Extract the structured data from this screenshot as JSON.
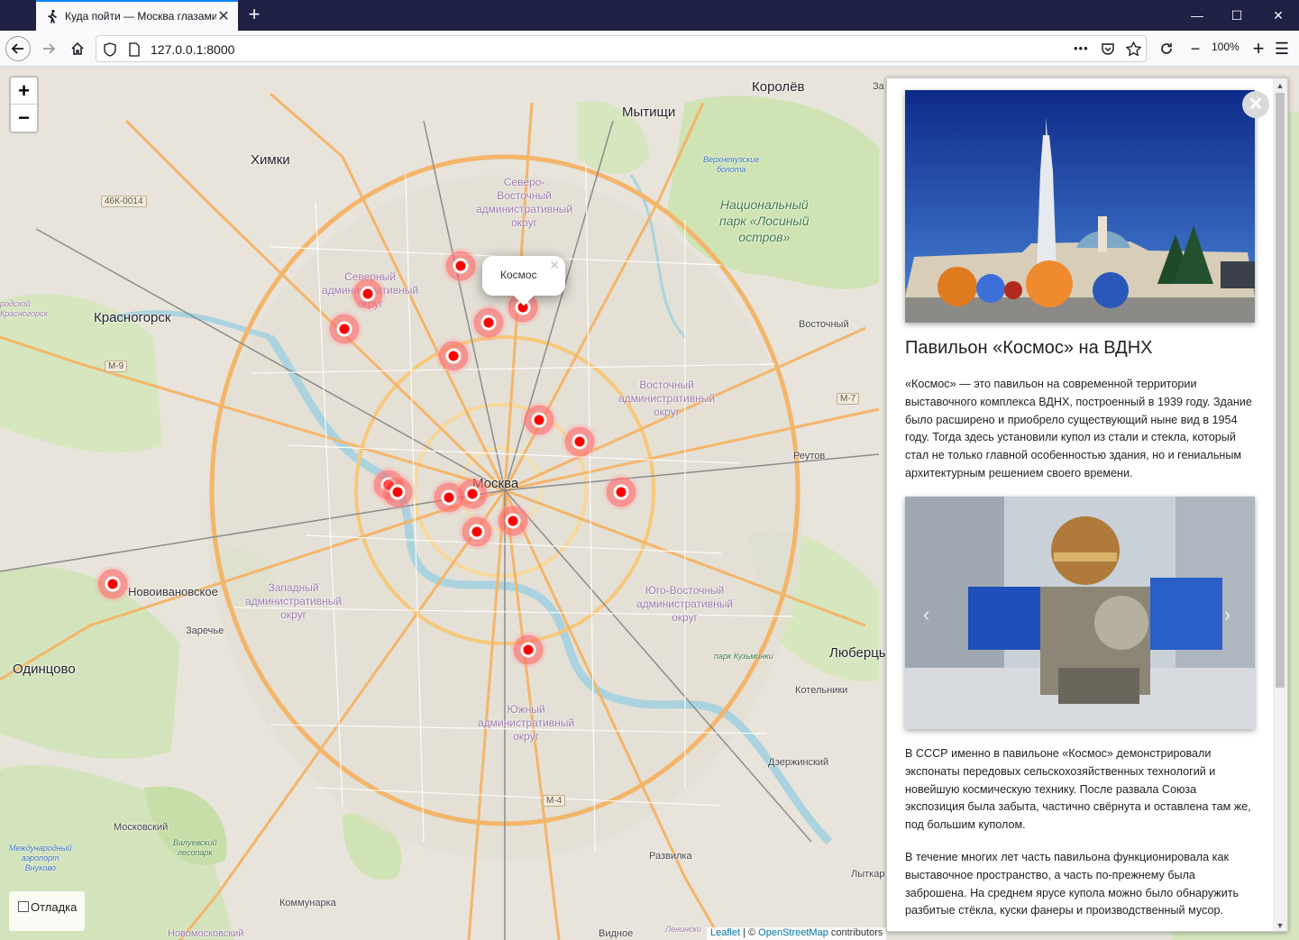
{
  "browser": {
    "tab_title": "Куда пойти — Москва глазами",
    "tab_close": "✕",
    "new_tab": "+",
    "url": "127.0.0.1:8000",
    "more": "•••",
    "zoom": "100%",
    "zoom_out": "−",
    "zoom_in": "+",
    "menu": "☰",
    "minimize": "—",
    "maximize": "☐",
    "close": "✕"
  },
  "map": {
    "zoom_in": "+",
    "zoom_out": "−",
    "labels": {
      "korolev": "Королёв",
      "mytishchi": "Мытищи",
      "khimki": "Химки",
      "krasnogorsk": "Красногорск",
      "moskva": "Москва",
      "odintsovo": "Одинцово",
      "novoivanovskoe": "Новоивановское",
      "zarechye": "Заречье",
      "lyubertsy": "Люберцы",
      "kotelniki": "Котельники",
      "dzerzhinsky": "Дзержинский",
      "reutov": "Реутов",
      "vostochny": "Восточный",
      "moskovsky": "Московский",
      "kommunarka": "Коммунарка",
      "razvilka": "Развилка",
      "vidnoe": "Видное",
      "lytkar": "Лыткар",
      "krasnogorsk_small": "родской\nКрасногорск",
      "za": "За",
      "district_sv": "Северо-\nВосточный\nадминистративный\nокруг",
      "district_s": "Северный\nадминистративный\nокруг",
      "district_v": "Восточный\nадминистративный\nокруг",
      "district_z": "Западный\nадминистративный\nокруг",
      "district_yv": "Юго-Восточный\nадминистративный\nокруг",
      "district_yu": "Южный\nадминистративный\nокруг",
      "park_losiny": "Национальный\nпарк «Лосиный\nостров»",
      "verkhneyauzskie": "Верхнеяузские\nболота",
      "park_kuzminki": "парк Кузьминки",
      "valuevsky": "Валуевский\nлесопарк",
      "vnukovo": "Международный\nаэропорт\nВнуково",
      "novomoskovsky": "Новомосковский",
      "leninsky": "Ленински",
      "road_46k": "46К-0014",
      "road_m9": "М-9",
      "road_m7": "М-7",
      "road_m4": "М-4"
    },
    "popup_title": "Космос",
    "popup_close": "✕",
    "debug_label": "Отладка",
    "attribution_leaflet": "Leaflet",
    "attribution_sep": " | © ",
    "attribution_osm": "OpenStreetMap",
    "attribution_tail": " contributors"
  },
  "panel": {
    "close": "✕",
    "title": "Павильон «Космос» на ВДНХ",
    "paragraph1": "«Космос» — это павильон на современной территории выставочного комплекса ВДНХ, построенный в 1939 году. Здание было расширено и приобрело существующий ныне вид в 1954 году. Тогда здесь установили купол из стали и стекла, который стал не только главной особенностью здания, но и гениальным архитектурным решением своего времени.",
    "paragraph2": "В СССР именно в павильоне «Космос» демонстрировали экспонаты передовых сельскохозяйственных технологий и новейшую космическую технику. После развала Союза экспозиция была забыта, частично свёрнута и оставлена там же, под большим куполом.",
    "paragraph3": "В течение многих лет часть павильона функционировала как выставочное пространство, а часть по-прежнему была заброшена. На среднем ярусе купола можно было обнаружить разбитые стёкла, куски фанеры и производственный мусор.",
    "carousel_prev": "‹",
    "carousel_next": "›",
    "scroll_up": "▲",
    "scroll_down": "▼"
  }
}
